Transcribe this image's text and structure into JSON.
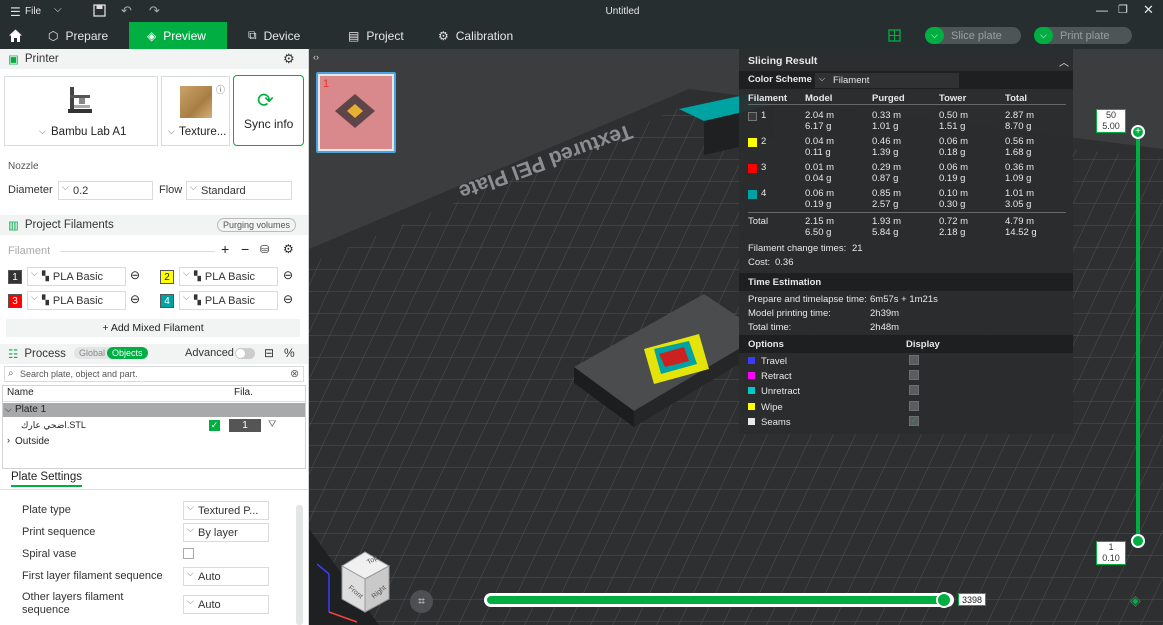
{
  "window": {
    "title": "Untitled",
    "file_label": "File"
  },
  "nav": {
    "tabs": [
      "Prepare",
      "Preview",
      "Device",
      "Project",
      "Calibration"
    ],
    "active": "Preview",
    "slice_label": "Slice plate",
    "print_label": "Print plate"
  },
  "printer": {
    "section_title": "Printer",
    "name": "Bambu Lab A1",
    "plate": "Texture...",
    "sync_label": "Sync info",
    "nozzle_label": "Nozzle",
    "diameter_label": "Diameter",
    "diameter_value": "0.2",
    "flow_label": "Flow",
    "flow_value": "Standard"
  },
  "filaments": {
    "section_title": "Project Filaments",
    "purge_label": "Purging volumes",
    "filament_label": "Filament",
    "items": [
      {
        "num": "1",
        "name": "PLA Basic",
        "color": "#333333",
        "text_color": "#ffffff"
      },
      {
        "num": "2",
        "name": "PLA Basic",
        "color": "#ffff00",
        "text_color": "#222222"
      },
      {
        "num": "3",
        "name": "PLA Basic",
        "color": "#ff0000",
        "text_color": "#ffffff"
      },
      {
        "num": "4",
        "name": "PLA Basic",
        "color": "#00a3a3",
        "text_color": "#ffffff"
      }
    ],
    "add_mixed": "+ Add Mixed Filament"
  },
  "process": {
    "section_title": "Process",
    "global_label": "Global",
    "objects_label": "Objects",
    "advanced_label": "Advanced",
    "search_placeholder": "Search plate, object and part.",
    "col_name": "Name",
    "col_fila": "Fila.",
    "plate_label": "Plate 1",
    "object_name": "اضحي عارك.STL",
    "object_fila": "1",
    "outside_label": "Outside"
  },
  "plate_settings": {
    "title": "Plate Settings",
    "rows": [
      {
        "label": "Plate type",
        "value": "Textured P..."
      },
      {
        "label": "Print sequence",
        "value": "By layer"
      },
      {
        "label": "Spiral vase",
        "value": ""
      },
      {
        "label": "First layer filament sequence",
        "value": "Auto"
      },
      {
        "label": "Other layers filament sequence",
        "value": "Auto"
      }
    ]
  },
  "viewport": {
    "plate_number": "1",
    "bed_text": "Textured PEI Plate",
    "layer_top": "50",
    "layer_top_height": "5.00",
    "layer_bottom": "1",
    "layer_bottom_height": "0.10",
    "move_value": "3398",
    "cube_top": "Top",
    "cube_front": "Front",
    "cube_right": "Right"
  },
  "slicing": {
    "title": "Slicing Result",
    "color_scheme_label": "Color Scheme",
    "color_scheme_value": "Filament",
    "headers": [
      "Filament",
      "Model",
      "Purged",
      "Tower",
      "Total"
    ],
    "rows": [
      {
        "id": "1",
        "color": "#3a3a3a",
        "model": [
          "2.04 m",
          "6.17 g"
        ],
        "purged": [
          "0.33 m",
          "1.01 g"
        ],
        "tower": [
          "0.50 m",
          "1.51 g"
        ],
        "total": [
          "2.87 m",
          "8.70 g"
        ]
      },
      {
        "id": "2",
        "color": "#ffff00",
        "model": [
          "0.04 m",
          "0.11 g"
        ],
        "purged": [
          "0.46 m",
          "1.39 g"
        ],
        "tower": [
          "0.06 m",
          "0.18 g"
        ],
        "total": [
          "0.56 m",
          "1.68 g"
        ]
      },
      {
        "id": "3",
        "color": "#ff0000",
        "model": [
          "0.01 m",
          "0.04 g"
        ],
        "purged": [
          "0.29 m",
          "0.87 g"
        ],
        "tower": [
          "0.06 m",
          "0.19 g"
        ],
        "total": [
          "0.36 m",
          "1.09 g"
        ]
      },
      {
        "id": "4",
        "color": "#00a3a3",
        "model": [
          "0.06 m",
          "0.19 g"
        ],
        "purged": [
          "0.85 m",
          "2.57 g"
        ],
        "tower": [
          "0.10 m",
          "0.30 g"
        ],
        "total": [
          "1.01 m",
          "3.05 g"
        ]
      }
    ],
    "total": {
      "label": "Total",
      "model": [
        "2.15 m",
        "6.50 g"
      ],
      "purged": [
        "1.93 m",
        "5.84 g"
      ],
      "tower": [
        "0.72 m",
        "2.18 g"
      ],
      "total": [
        "4.79 m",
        "14.52 g"
      ]
    },
    "change_times_label": "Filament change times:",
    "change_times": "21",
    "cost_label": "Cost:",
    "cost": "0.36",
    "time_title": "Time Estimation",
    "prepare_label": "Prepare and timelapse time:",
    "prepare_value": "6m57s + 1m21s",
    "model_time_label": "Model printing time:",
    "model_time_value": "2h39m",
    "total_time_label": "Total time:",
    "total_time_value": "2h48m",
    "options_label": "Options",
    "display_label": "Display",
    "options": [
      {
        "name": "Travel",
        "color": "#3b3bff"
      },
      {
        "name": "Retract",
        "color": "#ff00ff"
      },
      {
        "name": "Unretract",
        "color": "#00c8c8"
      },
      {
        "name": "Wipe",
        "color": "#ffff00"
      },
      {
        "name": "Seams",
        "color": "#e8e8e8"
      }
    ]
  }
}
